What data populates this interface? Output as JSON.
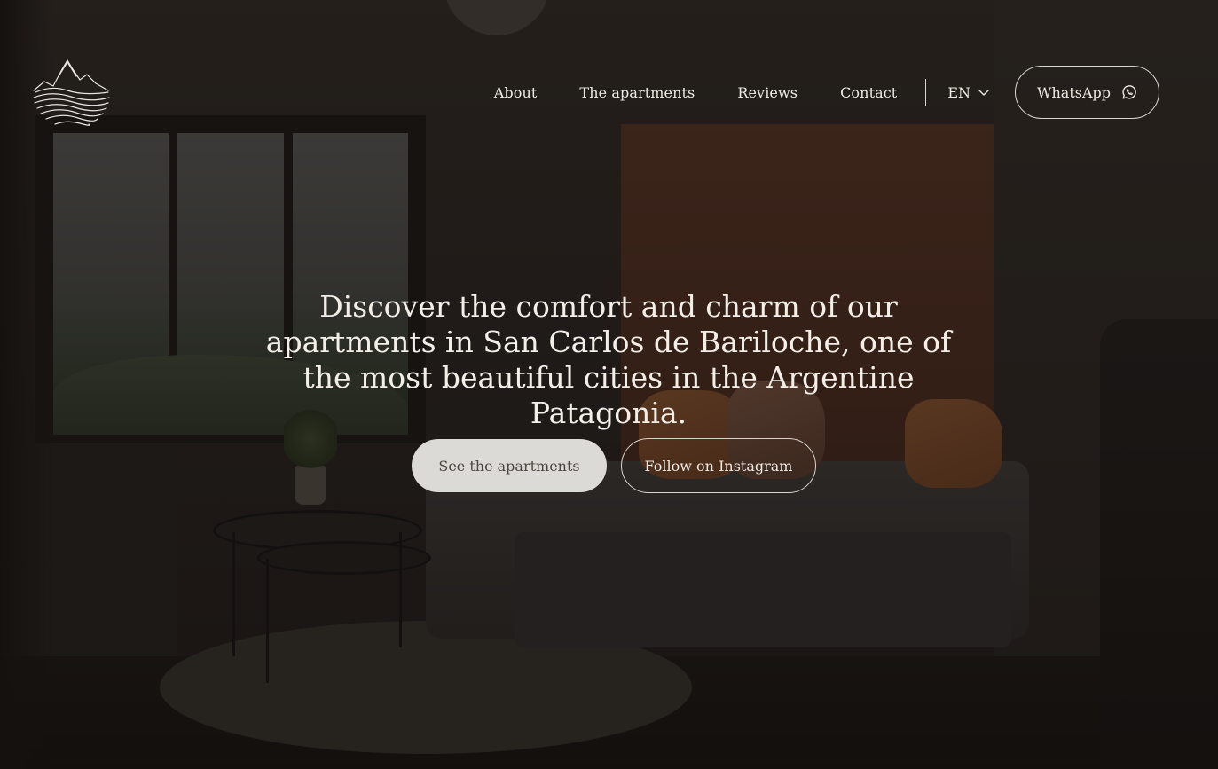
{
  "header": {
    "logo_name": "mountain-waves-logo",
    "nav": [
      {
        "label": "About"
      },
      {
        "label": "The apartments"
      },
      {
        "label": "Reviews"
      },
      {
        "label": "Contact"
      }
    ],
    "language": {
      "selected": "EN",
      "icon": "chevron-down-icon"
    },
    "whatsapp": {
      "label": "WhatsApp",
      "icon": "whatsapp-icon"
    }
  },
  "hero": {
    "headline": "Discover the comfort and charm of our apartments in San Carlos de Bariloche, one of the most beautiful cities in the Argentine Patagonia.",
    "primary_cta": "See the apartments",
    "secondary_cta": "Follow on Instagram"
  },
  "colors": {
    "overlay": "#120e0c",
    "text": "#f3efe8",
    "primary_button_bg": "#dcdad6",
    "primary_button_text": "#4c4640"
  }
}
